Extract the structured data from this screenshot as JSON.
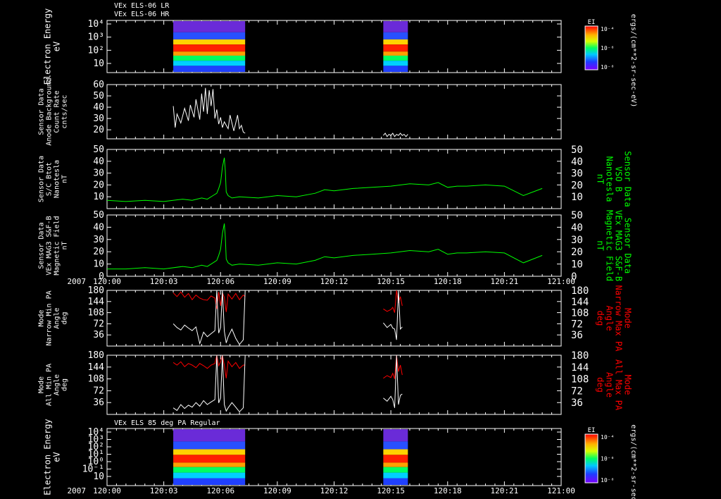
{
  "header": {
    "lines": [
      "VEx ELS-06 LR",
      "VEx ELS-06 HR"
    ]
  },
  "bottom_title": "VEx ELS 85 deg PA Regular",
  "time_axis": {
    "year": "2007",
    "tick_labels": [
      "120:00",
      "120:03",
      "120:06",
      "120:09",
      "120:12",
      "120:15",
      "120:18",
      "120:21",
      "121:00"
    ]
  },
  "colorbar_units": "ergs/(cm**2-sr-sec-eV)",
  "colors": {
    "white": "#ffffff",
    "green": "#00ff00",
    "red": "#ff0000",
    "frame": "#ffffff"
  },
  "chart_data": [
    {
      "type": "heatmap",
      "id": "spec1",
      "ylabel": [
        "Electron Energy",
        "eV"
      ],
      "y_tick_labels": [
        "10⁴",
        "10³",
        "10²",
        "10"
      ],
      "ylog": true,
      "ylim": [
        1,
        10000
      ],
      "colorbar": {
        "label": "EI",
        "tick_labels": [
          "10⁻⁴",
          "10⁻⁶",
          "10⁻⁸"
        ]
      },
      "data_intervals_min": [
        [
          3.5,
          7.3
        ],
        [
          14.6,
          15.9
        ]
      ]
    },
    {
      "type": "line",
      "id": "background",
      "ylabel": [
        "Sensor Data",
        "Anode Background",
        "Count Rate",
        "cnts/sec"
      ],
      "y_tick_labels": [
        "60",
        "50",
        "40",
        "30",
        "20"
      ],
      "ylim": [
        12,
        60
      ],
      "series": [
        {
          "color": "white",
          "x": [
            3.5,
            3.6,
            3.7,
            3.9,
            4.1,
            4.3,
            4.4,
            4.6,
            4.7,
            4.9,
            5.0,
            5.1,
            5.2,
            5.3,
            5.4,
            5.5,
            5.6,
            5.7,
            5.8,
            5.9,
            6.0,
            6.1,
            6.2,
            6.4,
            6.5,
            6.7,
            6.8,
            6.9,
            7.0,
            7.1,
            7.2,
            7.3
          ],
          "y": [
            41,
            22,
            34,
            26,
            39,
            28,
            42,
            31,
            47,
            29,
            52,
            36,
            57,
            34,
            55,
            41,
            56,
            30,
            38,
            25,
            31,
            22,
            27,
            21,
            33,
            19,
            26,
            33,
            21,
            24,
            18,
            17
          ]
        },
        {
          "color": "white",
          "x": [
            14.6,
            14.7,
            14.8,
            14.9,
            15.0,
            15.1,
            15.2,
            15.3,
            15.4,
            15.5,
            15.6,
            15.7,
            15.8,
            15.9
          ],
          "y": [
            15,
            17,
            14,
            16,
            15,
            17,
            14,
            16,
            15,
            17,
            15,
            16,
            14,
            16
          ]
        }
      ]
    },
    {
      "type": "line",
      "id": "bmag",
      "ylabel": [
        "Sensor Data",
        "S/C Btot",
        "Nanotesla",
        "nT"
      ],
      "y_tick_labels": [
        "50",
        "40",
        "30",
        "20",
        "10"
      ],
      "ylim": [
        0,
        50
      ],
      "right_ylabel": [
        "Sensor Data",
        "VSO B",
        "Nanotesla",
        "nT"
      ],
      "right_y_tick_labels": [
        "50",
        "40",
        "30",
        "20",
        "10"
      ],
      "series": [
        {
          "color": "green",
          "x": [
            0,
            1,
            2,
            3,
            4,
            4.5,
            5,
            5.3,
            5.6,
            5.8,
            5.9,
            6.0,
            6.1,
            6.2,
            6.25,
            6.3,
            6.4,
            6.6,
            7,
            8,
            9,
            10,
            11,
            11.5,
            12,
            13,
            14,
            15,
            16,
            17,
            17.5,
            18,
            18.5,
            19,
            20,
            21,
            22,
            23
          ],
          "y": [
            7,
            6,
            7,
            6,
            8,
            7,
            9,
            8,
            11,
            13,
            17,
            22,
            35,
            43,
            32,
            14,
            11,
            9,
            10,
            9,
            11,
            10,
            13,
            16,
            15,
            17,
            18,
            19,
            21,
            20,
            22,
            18,
            19,
            19,
            20,
            19,
            11,
            17
          ]
        }
      ]
    },
    {
      "type": "line",
      "id": "mag3",
      "ylabel": [
        "Sensor Data",
        "VEx MAG3 S&F-B",
        "Magnetic Field",
        "nT"
      ],
      "y_tick_labels": [
        "50",
        "40",
        "30",
        "20",
        "10",
        "0"
      ],
      "ylim": [
        0,
        50
      ],
      "right_ylabel": [
        "Sensor Data",
        "VEx MAG3 S&F-B",
        "Magnetic Field",
        "nT"
      ],
      "right_y_tick_labels": [
        "50",
        "40",
        "30",
        "20",
        "10",
        "0"
      ],
      "series": [
        {
          "color": "green",
          "x": [
            0,
            1,
            2,
            3,
            4,
            4.5,
            5,
            5.3,
            5.6,
            5.8,
            5.9,
            6.0,
            6.1,
            6.2,
            6.25,
            6.3,
            6.4,
            6.6,
            7,
            8,
            9,
            10,
            11,
            11.5,
            12,
            13,
            14,
            15,
            16,
            17,
            17.5,
            18,
            18.5,
            19,
            20,
            21,
            22,
            23
          ],
          "y": [
            6,
            6,
            7,
            6,
            8,
            7,
            9,
            8,
            11,
            13,
            17,
            22,
            35,
            43,
            32,
            14,
            11,
            9,
            10,
            9,
            11,
            10,
            13,
            16,
            15,
            17,
            18,
            19,
            21,
            20,
            22,
            18,
            19,
            19,
            20,
            19,
            11,
            17
          ]
        }
      ]
    },
    {
      "type": "line",
      "id": "pa_narrow",
      "ylabel": [
        "Mode",
        "Narrow Min PA",
        "Angle",
        "deg"
      ],
      "y_tick_labels": [
        "180",
        "144",
        "108",
        "72",
        "36"
      ],
      "ylim": [
        0,
        180
      ],
      "right_ylabel": [
        "Mode",
        "Narrow Max PA",
        "Angle",
        "deg"
      ],
      "right_y_tick_labels": [
        "180",
        "144",
        "108",
        "72",
        "36"
      ],
      "series": [
        {
          "color": "red",
          "x": [
            3.5,
            3.7,
            3.9,
            4.1,
            4.3,
            4.5,
            4.7,
            4.9,
            5.1,
            5.3,
            5.5,
            5.7,
            5.8,
            5.9,
            6.0,
            6.1,
            6.2,
            6.3,
            6.4,
            6.6,
            6.8,
            7.0,
            7.2,
            7.3
          ],
          "y": [
            172,
            160,
            175,
            158,
            170,
            150,
            165,
            155,
            150,
            148,
            162,
            155,
            120,
            175,
            130,
            172,
            158,
            110,
            168,
            152,
            170,
            150,
            165,
            160
          ]
        },
        {
          "color": "white",
          "x": [
            3.5,
            3.7,
            3.9,
            4.1,
            4.3,
            4.5,
            4.7,
            4.9,
            5.1,
            5.3,
            5.5,
            5.7,
            5.8,
            5.9,
            6.0,
            6.1,
            6.2,
            6.3,
            6.4,
            6.6,
            6.8,
            7.0,
            7.2,
            7.3
          ],
          "y": [
            72,
            60,
            52,
            68,
            58,
            50,
            62,
            8,
            45,
            30,
            40,
            50,
            180,
            42,
            60,
            180,
            48,
            10,
            30,
            55,
            25,
            5,
            20,
            180
          ]
        },
        {
          "color": "red",
          "x": [
            14.6,
            14.8,
            15.0,
            15.1,
            15.2,
            15.3,
            15.4,
            15.5,
            15.6
          ],
          "y": [
            120,
            112,
            118,
            125,
            108,
            180,
            140,
            160,
            130
          ]
        },
        {
          "color": "white",
          "x": [
            14.6,
            14.8,
            15.0,
            15.1,
            15.2,
            15.3,
            15.4,
            15.5,
            15.6
          ],
          "y": [
            75,
            60,
            70,
            58,
            55,
            20,
            180,
            55,
            62
          ]
        }
      ]
    },
    {
      "type": "line",
      "id": "pa_all",
      "ylabel": [
        "Mode",
        "All Min PA",
        "Angle",
        "deg"
      ],
      "y_tick_labels": [
        "180",
        "144",
        "108",
        "72",
        "36"
      ],
      "ylim": [
        0,
        180
      ],
      "right_ylabel": [
        "Mode",
        "All Max PA",
        "Angle",
        "deg"
      ],
      "right_y_tick_labels": [
        "180",
        "144",
        "108",
        "72",
        "36"
      ],
      "series": [
        {
          "color": "red",
          "x": [
            3.5,
            3.7,
            3.9,
            4.1,
            4.3,
            4.5,
            4.7,
            4.9,
            5.1,
            5.3,
            5.5,
            5.7,
            5.8,
            5.9,
            6.0,
            6.1,
            6.2,
            6.3,
            6.4,
            6.6,
            6.8,
            7.0,
            7.2,
            7.3
          ],
          "y": [
            158,
            150,
            160,
            145,
            155,
            150,
            142,
            155,
            148,
            140,
            150,
            155,
            180,
            148,
            160,
            180,
            150,
            110,
            162,
            145,
            158,
            140,
            150,
            150
          ]
        },
        {
          "color": "white",
          "x": [
            3.5,
            3.7,
            3.9,
            4.1,
            4.3,
            4.5,
            4.7,
            4.9,
            5.1,
            5.3,
            5.5,
            5.7,
            5.8,
            5.9,
            6.0,
            6.1,
            6.2,
            6.3,
            6.4,
            6.6,
            6.8,
            7.0,
            7.2,
            7.3
          ],
          "y": [
            20,
            12,
            30,
            18,
            28,
            22,
            36,
            25,
            42,
            30,
            38,
            45,
            180,
            35,
            50,
            180,
            30,
            10,
            20,
            36,
            22,
            8,
            20,
            180
          ]
        },
        {
          "color": "red",
          "x": [
            14.6,
            14.8,
            15.0,
            15.1,
            15.2,
            15.3,
            15.4,
            15.5,
            15.6
          ],
          "y": [
            110,
            118,
            112,
            125,
            108,
            180,
            130,
            150,
            120
          ]
        },
        {
          "color": "white",
          "x": [
            14.6,
            14.8,
            15.0,
            15.1,
            15.2,
            15.3,
            15.4,
            15.5,
            15.6
          ],
          "y": [
            50,
            40,
            55,
            45,
            20,
            180,
            30,
            58,
            62
          ]
        }
      ]
    },
    {
      "type": "heatmap",
      "id": "spec2",
      "ylabel": [
        "Electron Energy",
        "eV"
      ],
      "y_tick_labels": [
        "10⁴",
        "10³",
        "10²",
        "10¹",
        "10⁰",
        "10⁻¹",
        "10"
      ],
      "ylog": true,
      "ylim": [
        1,
        10000
      ],
      "colorbar": {
        "label": "EI",
        "tick_labels": [
          "10⁻⁴",
          "10⁻⁶",
          "10⁻⁸"
        ]
      },
      "data_intervals_min": [
        [
          3.5,
          7.3
        ],
        [
          14.6,
          15.9
        ]
      ]
    }
  ]
}
